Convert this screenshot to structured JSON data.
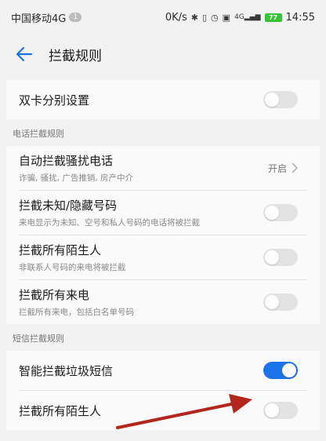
{
  "status_bar": {
    "carrier": "中国移动4G",
    "sim_badge": "1",
    "speed": "0K/s",
    "signal_label": "4G",
    "battery": "77",
    "time": "14:55"
  },
  "header": {
    "title": "拦截规则"
  },
  "dual_sim": {
    "label": "双卡分别设置",
    "enabled": false
  },
  "call_section": {
    "title": "电话拦截规则",
    "items": [
      {
        "label": "自动拦截骚扰电话",
        "sub": "诈骗, 骚扰, 广告推销, 房产中介",
        "value": "开启"
      },
      {
        "label": "拦截未知/隐藏号码",
        "sub": "来电显示为未知、空号和私人号码的电话将被拦截",
        "enabled": false
      },
      {
        "label": "拦截所有陌生人",
        "sub": "非联系人号码的来电将被拦截",
        "enabled": false
      },
      {
        "label": "拦截所有来电",
        "sub": "拦截所有来电，包括白名单号码",
        "enabled": false
      }
    ]
  },
  "sms_section": {
    "title": "短信拦截规则",
    "items": [
      {
        "label": "智能拦截垃圾短信",
        "enabled": true
      },
      {
        "label": "拦截所有陌生人",
        "enabled": false
      }
    ]
  },
  "colors": {
    "accent": "#1a73e8",
    "annotation_arrow": "#b3261e"
  }
}
